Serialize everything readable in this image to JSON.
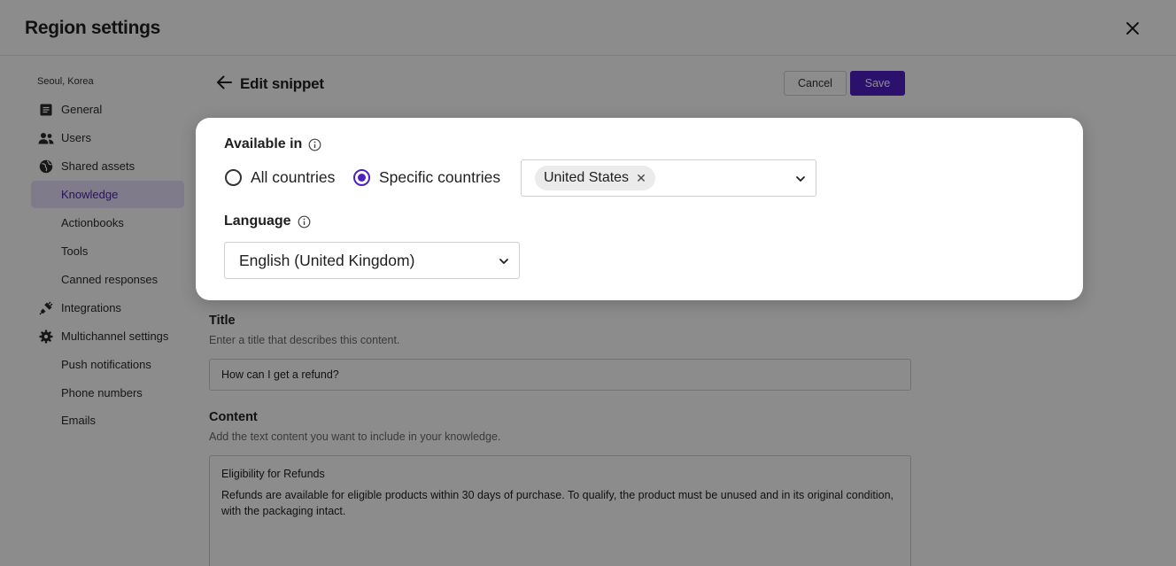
{
  "app": {
    "title": "Region settings"
  },
  "sidebar": {
    "region": "Seoul, Korea",
    "items": [
      {
        "label": "General",
        "icon": "list-icon"
      },
      {
        "label": "Users",
        "icon": "users-icon"
      },
      {
        "label": "Shared assets",
        "icon": "globe-icon"
      },
      {
        "label": "Knowledge",
        "active": true
      },
      {
        "label": "Actionbooks"
      },
      {
        "label": "Tools"
      },
      {
        "label": "Canned responses"
      },
      {
        "label": "Integrations",
        "icon": "plug-icon"
      },
      {
        "label": "Multichannel settings",
        "icon": "gear-icon"
      },
      {
        "label": "Push notifications"
      },
      {
        "label": "Phone numbers"
      },
      {
        "label": "Emails"
      }
    ]
  },
  "editor": {
    "title": "Edit snippet",
    "cancel_label": "Cancel",
    "save_label": "Save",
    "title_field": {
      "label": "Title",
      "help": "Enter a title that describes this content.",
      "value": "How can I get a refund?"
    },
    "content_field": {
      "label": "Content",
      "help": "Add the text content you want to include in your knowledge.",
      "heading": "Eligibility for Refunds",
      "body": "Refunds are available for eligible products within 30 days of purchase. To qualify, the product must be unused and in its original condition, with the packaging intact."
    }
  },
  "modal": {
    "available_in": {
      "label": "Available in",
      "options": [
        "All countries",
        "Specific countries"
      ],
      "selected": "Specific countries",
      "countries": [
        "United States"
      ]
    },
    "language": {
      "label": "Language",
      "value": "English (United Kingdom)"
    }
  },
  "colors": {
    "accent": "#4f1fc4",
    "active_bg": "#e7e0fb",
    "overlay": "#000000"
  }
}
